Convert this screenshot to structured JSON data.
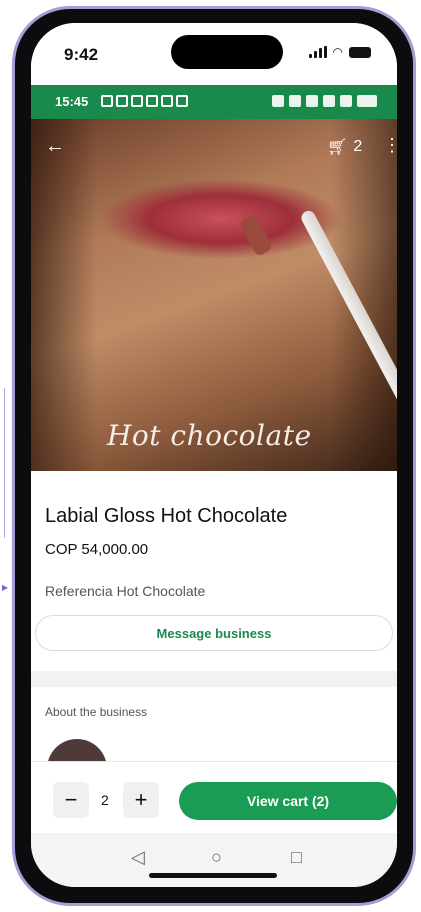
{
  "ios_status": {
    "time": "9:42"
  },
  "android_status": {
    "time": "15:45"
  },
  "header": {
    "cart_count": "2"
  },
  "hero": {
    "caption": "Hot chocolate"
  },
  "product": {
    "title": "Labial Gloss Hot Chocolate",
    "price": "COP 54,000.00",
    "reference": "Referencia Hot Chocolate"
  },
  "actions": {
    "message_label": "Message business"
  },
  "business": {
    "section_title": "About the business"
  },
  "cart_bar": {
    "quantity": "2",
    "view_cart_label": "View cart (2)",
    "minus": "−",
    "plus": "+"
  },
  "nav": {
    "back": "◁",
    "home": "○",
    "recent": "□"
  },
  "colors": {
    "whatsapp_green": "#1a8a4c",
    "button_green": "#1a9c55"
  }
}
